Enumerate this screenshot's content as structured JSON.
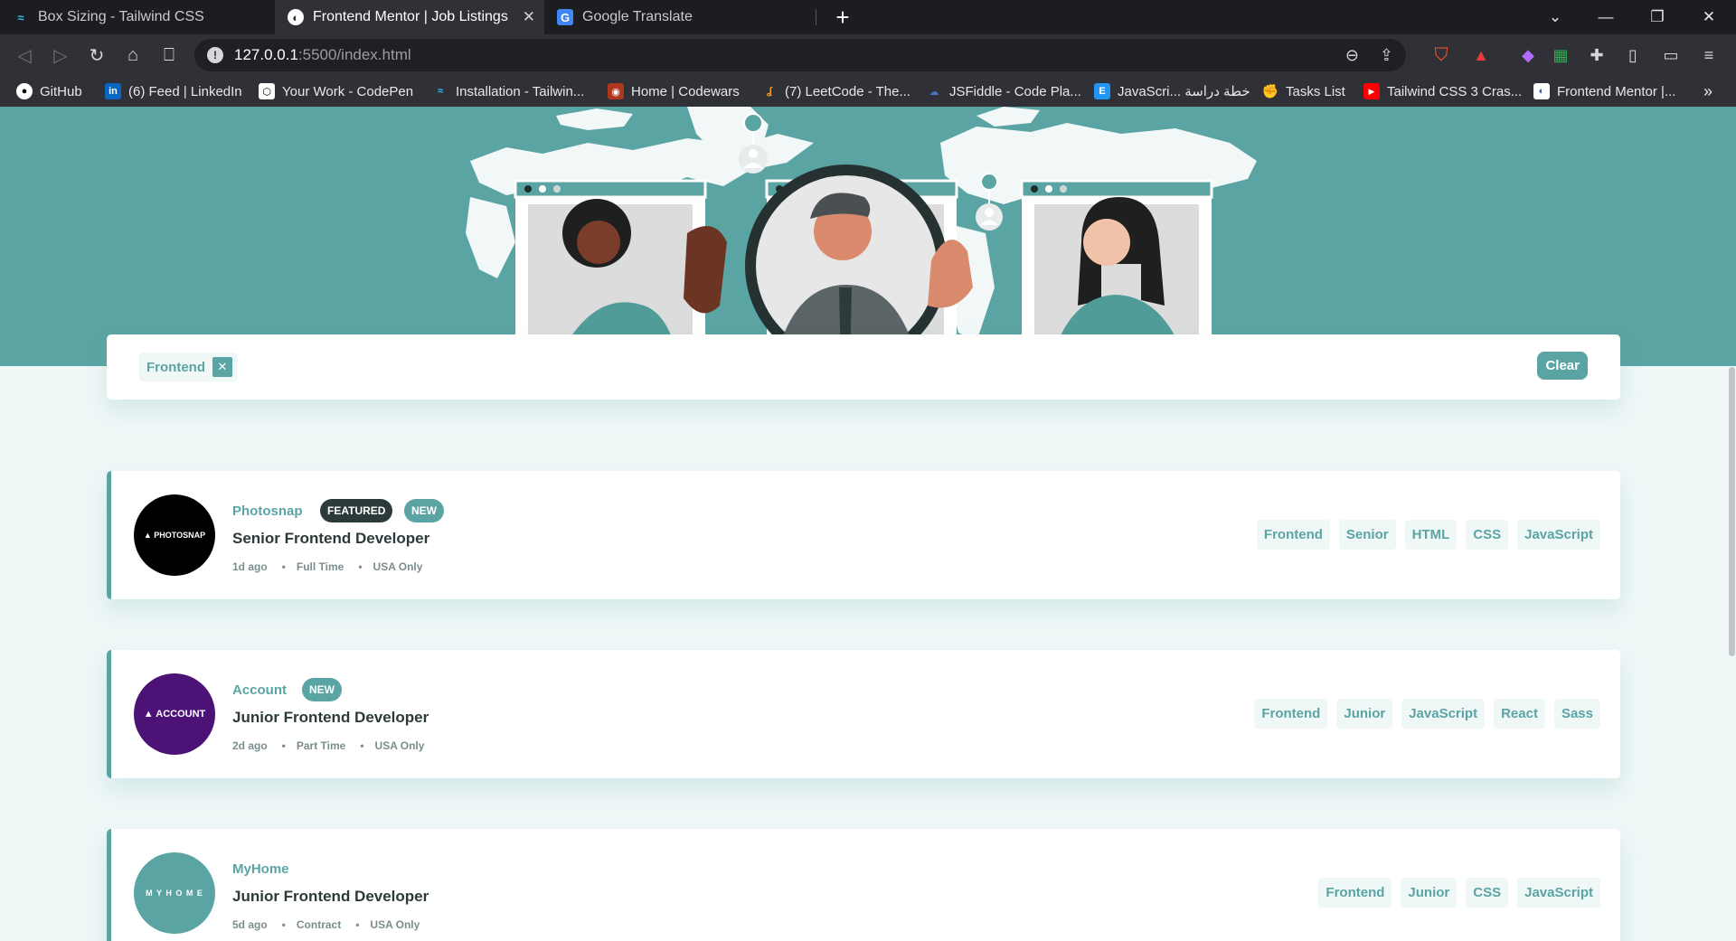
{
  "browser": {
    "tabs": [
      {
        "title": "Box Sizing - Tailwind CSS",
        "active": false
      },
      {
        "title": "Frontend Mentor | Job Listings",
        "active": true
      },
      {
        "title": "Google Translate",
        "active": false
      }
    ],
    "url_host": "127.0.0.1",
    "url_path": ":5500/index.html",
    "bookmarks": [
      {
        "label": "GitHub"
      },
      {
        "label": "(6) Feed | LinkedIn"
      },
      {
        "label": "Your Work - CodePen"
      },
      {
        "label": "Installation - Tailwin..."
      },
      {
        "label": "Home | Codewars"
      },
      {
        "label": "(7) LeetCode - The..."
      },
      {
        "label": "JSFiddle - Code Pla..."
      },
      {
        "label": "JavaScri... خطة دراسة"
      },
      {
        "label": "Tasks List"
      },
      {
        "label": "Tailwind CSS 3 Cras..."
      },
      {
        "label": "Frontend Mentor |..."
      }
    ],
    "more": "»"
  },
  "filter": {
    "chips": [
      "Frontend"
    ],
    "remove_symbol": "✕",
    "clear_label": "Clear"
  },
  "jobs": [
    {
      "company": "Photosnap",
      "logo_text": "▲ PHOTOSNAP",
      "logo_color": "#000000",
      "featured_label": "FEATURED",
      "new_label": "NEW",
      "position": "Senior Frontend Developer",
      "posted": "1d ago",
      "contract": "Full Time",
      "location": "USA Only",
      "tags": [
        "Frontend",
        "Senior",
        "HTML",
        "CSS",
        "JavaScript"
      ]
    },
    {
      "company": "Account",
      "logo_text": "▲ ACCOUNT",
      "logo_color": "#4d1275",
      "new_label": "NEW",
      "position": "Junior Frontend Developer",
      "posted": "2d ago",
      "contract": "Part Time",
      "location": "USA Only",
      "tags": [
        "Frontend",
        "Junior",
        "JavaScript",
        "React",
        "Sass"
      ]
    },
    {
      "company": "MyHome",
      "logo_text": "M Y H O M E",
      "logo_color": "#5ba4a4",
      "position": "Junior Frontend Developer",
      "posted": "5d ago",
      "contract": "Contract",
      "location": "USA Only",
      "tags": [
        "Frontend",
        "Junior",
        "CSS",
        "JavaScript"
      ]
    }
  ],
  "colors": {
    "primary": "#5ba4a4",
    "background": "#eff7f7",
    "dark": "#2c3a3a",
    "gray": "#7b8e8e"
  }
}
